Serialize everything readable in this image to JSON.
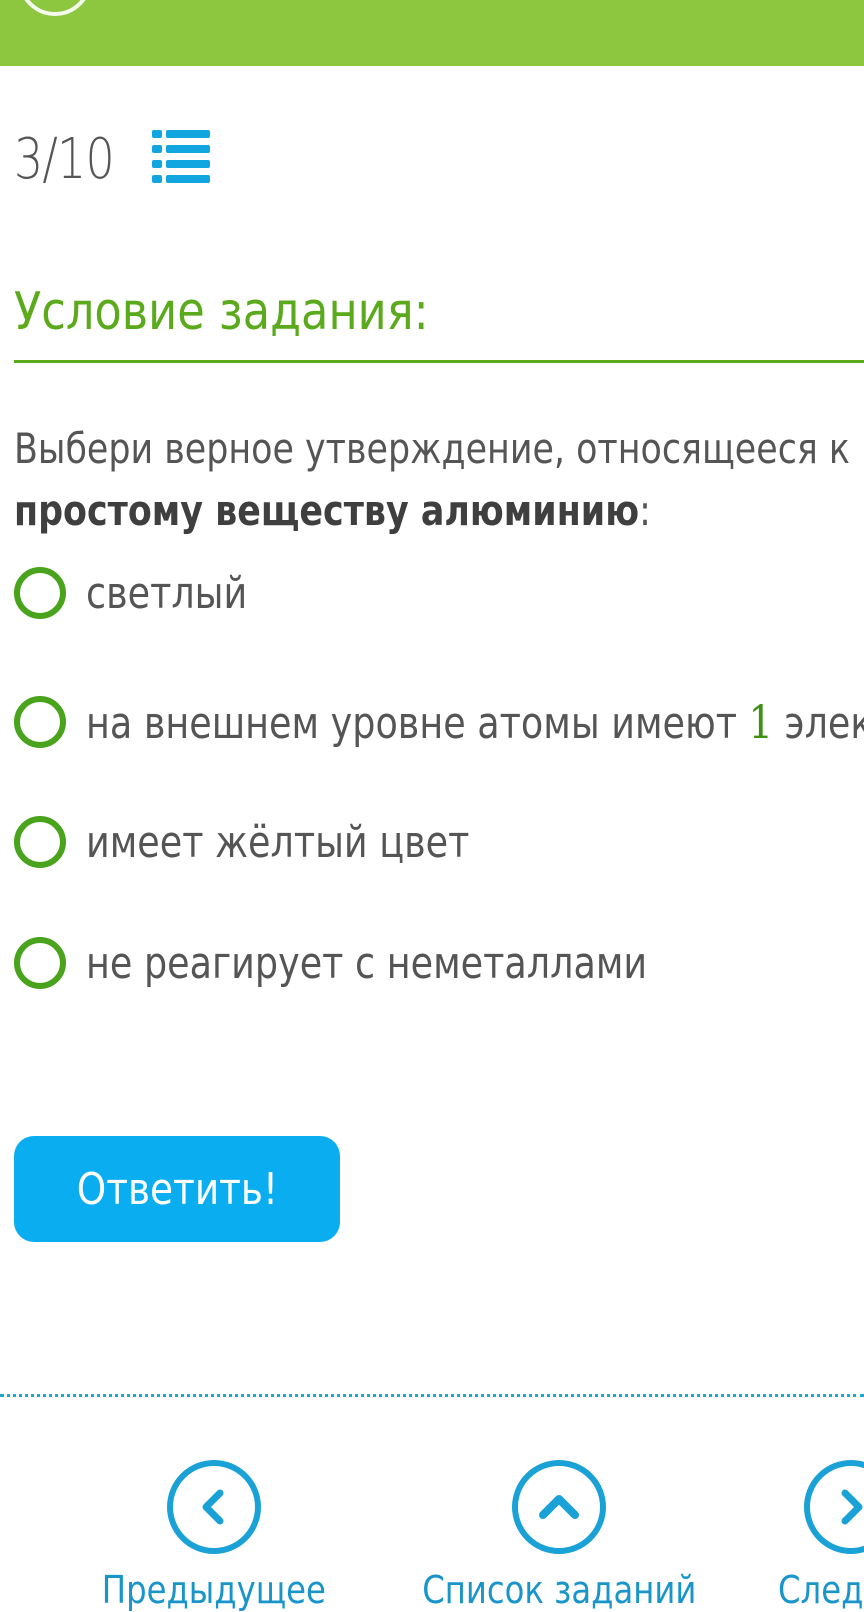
{
  "progress": {
    "current_of_total": "3/10"
  },
  "section": {
    "title": "Условие задания:"
  },
  "question": {
    "line1": "Выбери верное утверждение, относящееся к",
    "line2_bold": "простому веществу алюминию",
    "line2_tail": ":"
  },
  "options": [
    {
      "label": "светлый"
    },
    {
      "label_pre": "на внешнем уровне атомы имеют ",
      "number": "1",
      "label_post": " элек"
    },
    {
      "label": "имеет жёлтый цвет"
    },
    {
      "label": "не реагирует с неметаллами"
    }
  ],
  "answer_button": {
    "label": "Ответить!"
  },
  "nav": {
    "previous": "Предыдущее",
    "task_list": "Список заданий",
    "next": "Следу"
  },
  "colors": {
    "topbar": "#8dc63f",
    "accent_green": "#5aaa1c",
    "radio_green": "#4aa31d",
    "button_blue": "#0aaef0",
    "nav_blue": "#1aa2d6"
  }
}
